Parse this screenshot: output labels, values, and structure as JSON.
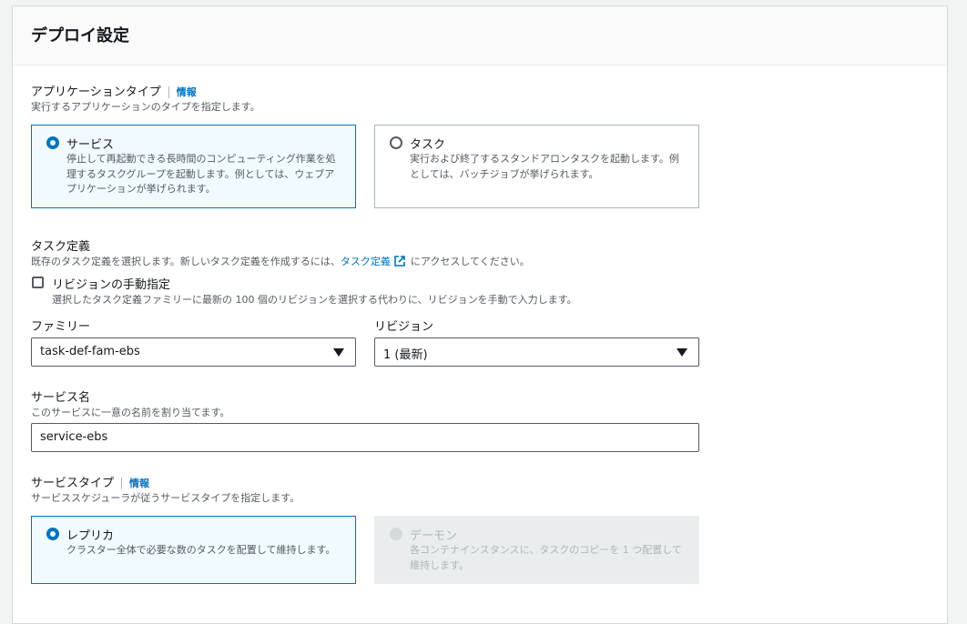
{
  "section": {
    "title": "デプロイ設定"
  },
  "app_type": {
    "label": "アプリケーションタイプ",
    "info": "情報",
    "description": "実行するアプリケーションのタイプを指定します。",
    "options": [
      {
        "title": "サービス",
        "description": "停止して再起動できる長時間のコンピューティング作業を処理するタスクグループを起動します。例としては、ウェブアプリケーションが挙げられます。",
        "selected": true
      },
      {
        "title": "タスク",
        "description": "実行および終了するスタンドアロンタスクを起動します。例としては、バッチジョブが挙げられます。",
        "selected": false
      }
    ]
  },
  "task_def": {
    "label": "タスク定義",
    "description_before": "既存のタスク定義を選択します。新しいタスク定義を作成するには、",
    "link": "タスク定義",
    "description_after": "にアクセスしてください。",
    "manual_revision": {
      "label": "リビジョンの手動指定",
      "description": "選択したタスク定義ファミリーに最新の 100 個のリビジョンを選択する代わりに、リビジョンを手動で入力します。",
      "checked": false
    },
    "family": {
      "label": "ファミリー",
      "value": "task-def-fam-ebs"
    },
    "revision": {
      "label": "リビジョン",
      "value": "1 (最新)"
    }
  },
  "service_name": {
    "label": "サービス名",
    "description": "このサービスに一意の名前を割り当てます。",
    "value": "service-ebs"
  },
  "service_type": {
    "label": "サービスタイプ",
    "info": "情報",
    "description": "サービススケジューラが従うサービスタイプを指定します。",
    "options": [
      {
        "title": "レプリカ",
        "description": "クラスター全体で必要な数のタスクを配置して維持します。",
        "selected": true,
        "disabled": false
      },
      {
        "title": "デーモン",
        "description": "各コンテナインスタンスに、タスクのコピーを 1 つ配置して維持します。",
        "selected": false,
        "disabled": true
      }
    ]
  },
  "colors": {
    "accent": "#0073bb",
    "border": "#aab7b8",
    "disabled": "#eaeded"
  }
}
